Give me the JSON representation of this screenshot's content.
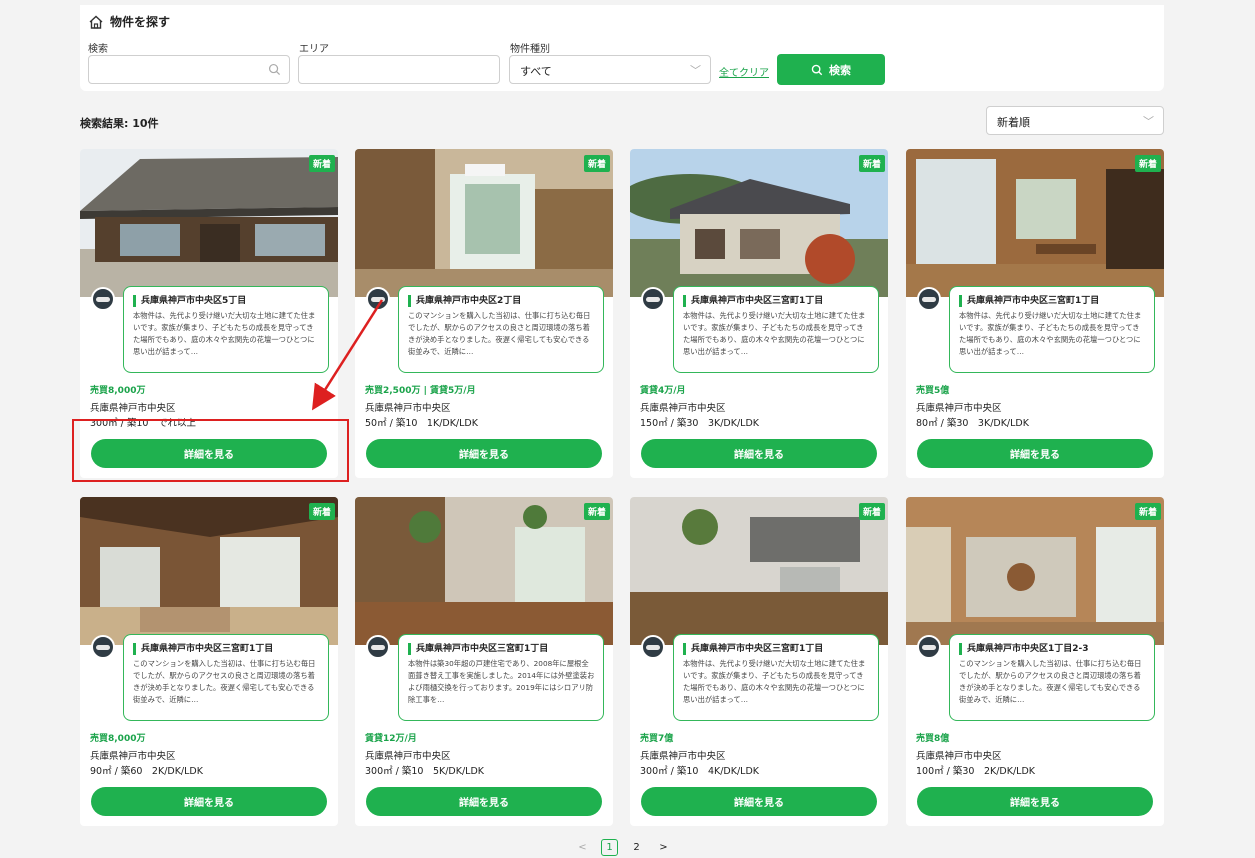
{
  "search": {
    "title": "物件を探す",
    "keyword_label": "検索",
    "keyword_value": "",
    "area_label": "エリア",
    "area_value": "",
    "type_label": "物件種別",
    "type_value": "すべて",
    "clear_label": "全てクリア",
    "search_button_label": "検索"
  },
  "results": {
    "count_label": "検索結果: 10件",
    "sort_value": "新着順"
  },
  "colors": {
    "accent": "#1fb14f",
    "annotation": "#dd2020"
  },
  "cards": [
    {
      "badge": "新着",
      "title": "兵庫県神戸市中央区5丁目",
      "description": "本物件は、先代より受け継いだ大切な土地に建てた住まいです。家族が集まり、子どもたちの成長を見守ってきた場所でもあり、庭の木々や玄関先の花壇一つひとつに思い出が詰まって…",
      "price": "売買8,000万",
      "address": "兵庫県神戸市中央区",
      "spec": "300㎡ / 築10　でれ以上",
      "button_label": "詳細を見る"
    },
    {
      "badge": "新着",
      "title": "兵庫県神戸市中央区2丁目",
      "description": "このマンションを購入した当初は、仕事に打ち込む毎日でしたが、駅からのアクセスの良さと周辺環境の落ち着きが決め手となりました。夜遅く帰宅しても安心できる街並みで、近隣に…",
      "price": "売買2,500万 | 賃貸5万/月",
      "address": "兵庫県神戸市中央区",
      "spec": "50㎡ / 築10　1K/DK/LDK",
      "button_label": "詳細を見る"
    },
    {
      "badge": "新着",
      "title": "兵庫県神戸市中央区三宮町1丁目",
      "description": "本物件は、先代より受け継いだ大切な土地に建てた住まいです。家族が集まり、子どもたちの成長を見守ってきた場所でもあり、庭の木々や玄関先の花壇一つひとつに思い出が詰まって…",
      "price": "賃貸4万/月",
      "address": "兵庫県神戸市中央区",
      "spec": "150㎡ / 築30　3K/DK/LDK",
      "button_label": "詳細を見る"
    },
    {
      "badge": "新着",
      "title": "兵庫県神戸市中央区三宮町1丁目",
      "description": "本物件は、先代より受け継いだ大切な土地に建てた住まいです。家族が集まり、子どもたちの成長を見守ってきた場所でもあり、庭の木々や玄関先の花壇一つひとつに思い出が詰まって…",
      "price": "売買5億",
      "address": "兵庫県神戸市中央区",
      "spec": "80㎡ / 築30　3K/DK/LDK",
      "button_label": "詳細を見る"
    },
    {
      "badge": "新着",
      "title": "兵庫県神戸市中央区三宮町1丁目",
      "description": "このマンションを購入した当初は、仕事に打ち込む毎日でしたが、駅からのアクセスの良さと周辺環境の落ち着きが決め手となりました。夜遅く帰宅しても安心できる街並みで、近隣に…",
      "price": "売買8,000万",
      "address": "兵庫県神戸市中央区",
      "spec": "90㎡ / 築60　2K/DK/LDK",
      "button_label": "詳細を見る"
    },
    {
      "badge": "新着",
      "title": "兵庫県神戸市中央区三宮町1丁目",
      "description": "本物件は築30年超の戸建住宅であり、2008年に屋根全面葺き替え工事を実施しました。2014年には外壁塗装および雨樋交換を行っております。2019年にはシロアリ防除工事を…",
      "price": "賃貸12万/月",
      "address": "兵庫県神戸市中央区",
      "spec": "300㎡ / 築10　5K/DK/LDK",
      "button_label": "詳細を見る"
    },
    {
      "badge": "新着",
      "title": "兵庫県神戸市中央区三宮町1丁目",
      "description": "本物件は、先代より受け継いだ大切な土地に建てた住まいです。家族が集まり、子どもたちの成長を見守ってきた場所でもあり、庭の木々や玄関先の花壇一つひとつに思い出が詰まって…",
      "price": "売買7億",
      "address": "兵庫県神戸市中央区",
      "spec": "300㎡ / 築10　4K/DK/LDK",
      "button_label": "詳細を見る"
    },
    {
      "badge": "新着",
      "title": "兵庫県神戸市中央区1丁目2-3",
      "description": "このマンションを購入した当初は、仕事に打ち込む毎日でしたが、駅からのアクセスの良さと周辺環境の落ち着きが決め手となりました。夜遅く帰宅しても安心できる街並みで、近隣に…",
      "price": "売買8億",
      "address": "兵庫県神戸市中央区",
      "spec": "100㎡ / 築30　2K/DK/LDK",
      "button_label": "詳細を見る"
    }
  ],
  "pagination": {
    "prev": "<",
    "pages": [
      "1",
      "2"
    ],
    "next": ">"
  }
}
